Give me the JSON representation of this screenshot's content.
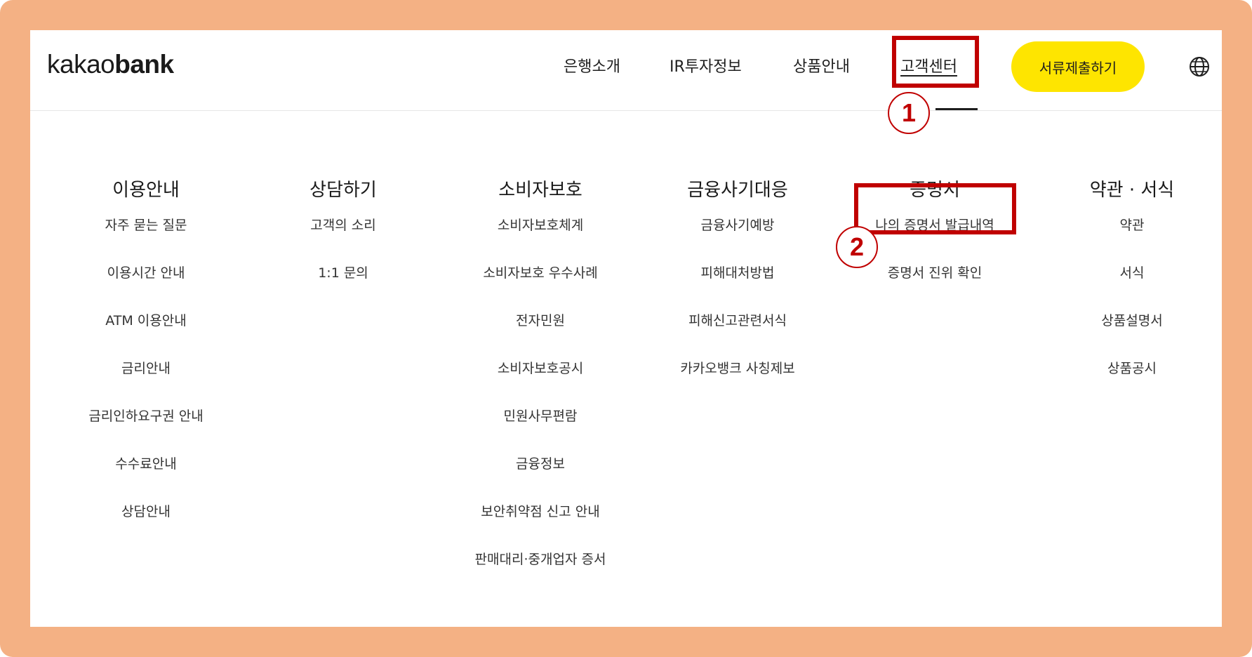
{
  "logo": {
    "kakao": "kakao",
    "bank": "bank"
  },
  "nav": [
    {
      "label": "은행소개"
    },
    {
      "label": "IR투자정보"
    },
    {
      "label": "상품안내"
    },
    {
      "label": "고객센터"
    }
  ],
  "submit_button": "서류제출하기",
  "globe_icon": "globe-icon",
  "annotations": {
    "one": "1",
    "two": "2",
    "color": "#c00000"
  },
  "colors": {
    "accent": "#fee500",
    "frame": "#f4b184"
  },
  "menu": [
    {
      "title": "이용안내",
      "items": [
        "자주 묻는 질문",
        "이용시간 안내",
        "ATM 이용안내",
        "금리안내",
        "금리인하요구권 안내",
        "수수료안내",
        "상담안내"
      ]
    },
    {
      "title": "상담하기",
      "items": [
        "고객의 소리",
        "1:1 문의"
      ]
    },
    {
      "title": "소비자보호",
      "items": [
        "소비자보호체계",
        "소비자보호 우수사례",
        "전자민원",
        "소비자보호공시",
        "민원사무편람",
        "금융정보",
        "보안취약점 신고 안내",
        "판매대리·중개업자 증서"
      ]
    },
    {
      "title": "금융사기대응",
      "items": [
        "금융사기예방",
        "피해대처방법",
        "피해신고관련서식",
        "카카오뱅크 사칭제보"
      ]
    },
    {
      "title": "증명서",
      "items": [
        "나의 증명서 발급내역",
        "증명서 진위 확인"
      ]
    },
    {
      "title": "약관 · 서식",
      "items": [
        "약관",
        "서식",
        "상품설명서",
        "상품공시"
      ]
    }
  ]
}
